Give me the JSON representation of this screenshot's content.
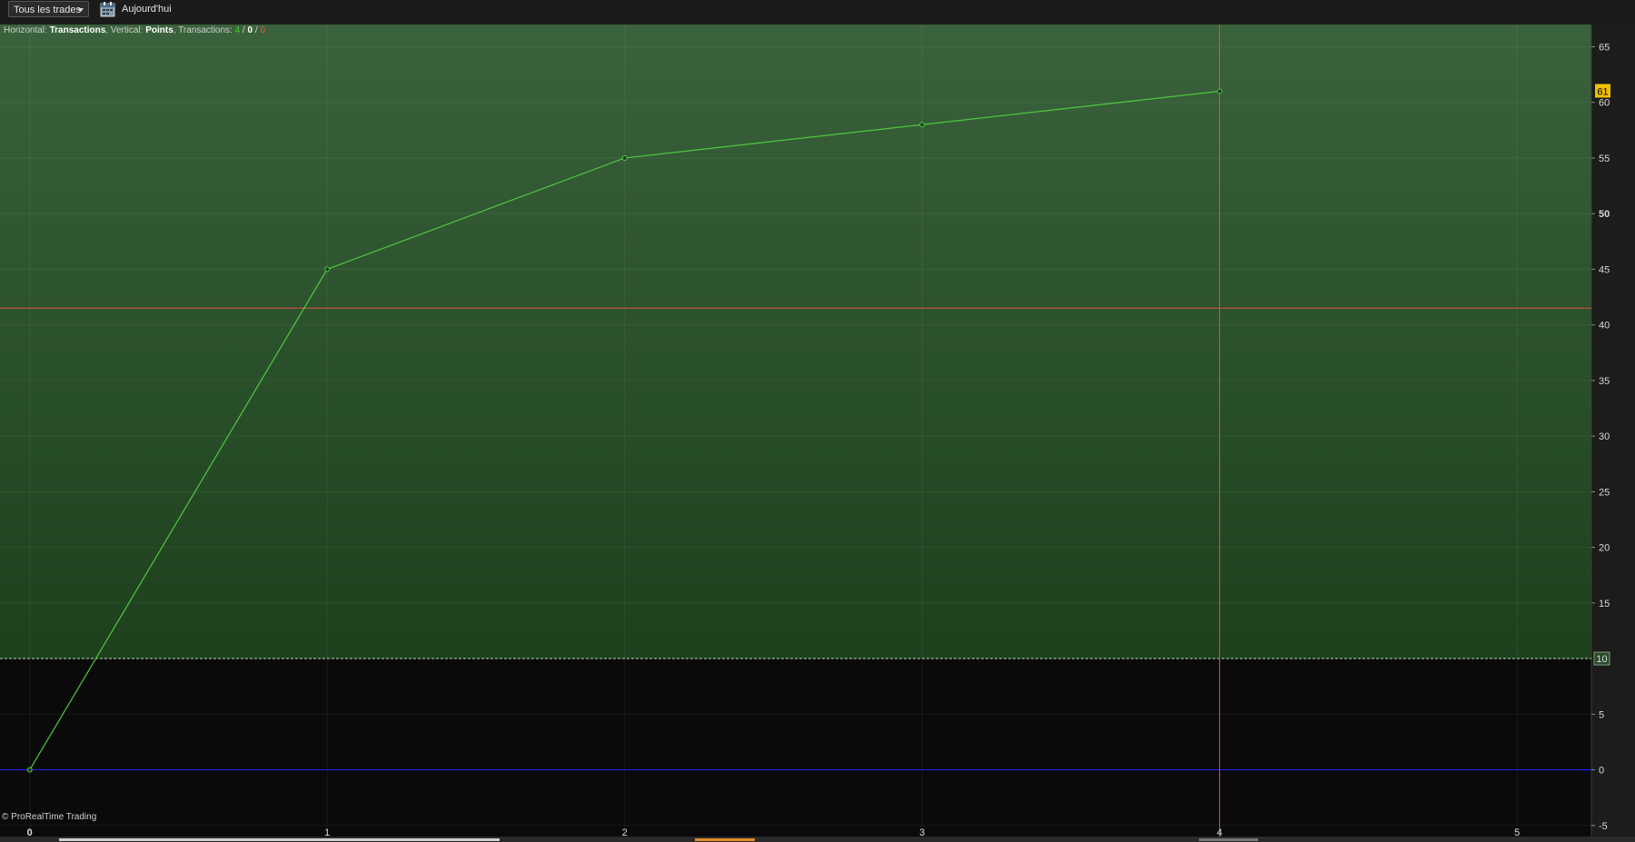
{
  "toolbar": {
    "filter_label": "Tous les trades",
    "date_label": "Aujourd'hui",
    "calendar_icon": "calendar-icon"
  },
  "info": {
    "prefix_horizontal": "Horizontal:",
    "horizontal_value": "Transactions",
    "prefix_vertical": ", Vertical:",
    "vertical_value": "Points",
    "prefix_transactions": ", Transactions:",
    "count_total": "4",
    "separator1": " / ",
    "count_neutral": "0",
    "separator2": " / ",
    "count_negative": "0"
  },
  "copyright": "© ProRealTime Trading",
  "colors": {
    "line": "#4ec93e",
    "zone_top": "#3a623c",
    "zone_bottom": "#1d401d",
    "crosshair": "#e05040",
    "zero_line": "#2020ff",
    "marker_label_bg": "#f0c000"
  },
  "chart_data": {
    "type": "line",
    "x": [
      0,
      1,
      2,
      3,
      4
    ],
    "y": [
      0,
      45,
      55,
      58,
      61
    ],
    "xlim": [
      -0.1,
      5.25
    ],
    "ylim": [
      -6,
      67
    ],
    "x_ticks": [
      0,
      1,
      2,
      3,
      4,
      5
    ],
    "y_ticks": [
      -5,
      0,
      5,
      10,
      15,
      20,
      25,
      30,
      35,
      40,
      45,
      50,
      55,
      60,
      65
    ],
    "bold_y_ticks": [
      50
    ],
    "threshold": 10,
    "current_marker": 61,
    "crosshair": {
      "x": 4,
      "y": 41.5
    },
    "grid": true,
    "xlabel": "Transactions",
    "ylabel": "Points"
  }
}
